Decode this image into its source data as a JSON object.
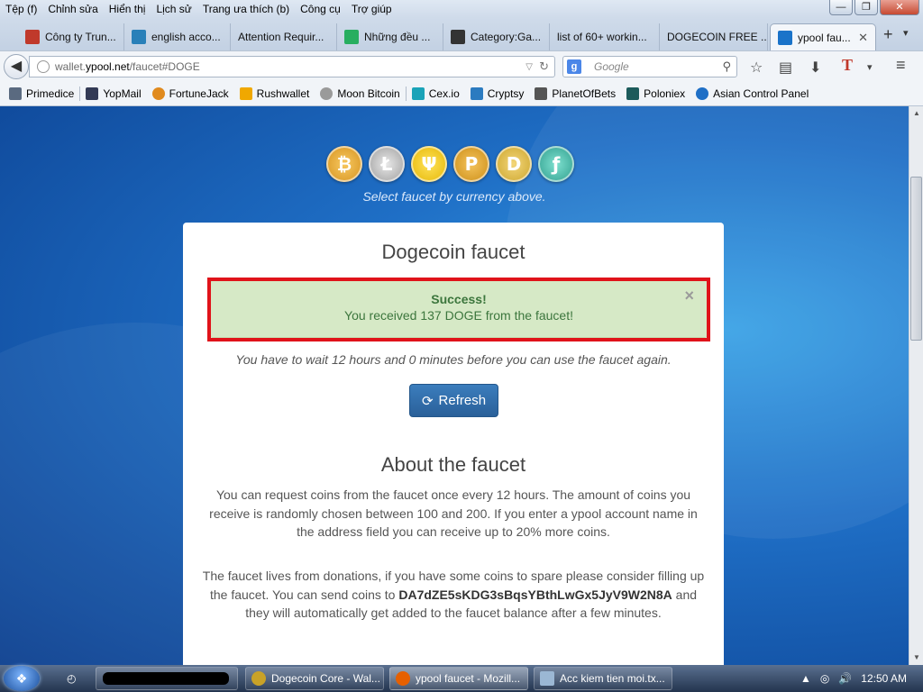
{
  "menubar": {
    "items": [
      "Tệp (f)",
      "Chỉnh sửa",
      "Hiển thị",
      "Lịch sử",
      "Trang ưa thích (b)",
      "Công cụ",
      "Trợ giúp"
    ]
  },
  "window_controls": {
    "minimize": "—",
    "maximize": "❐",
    "close": "✕"
  },
  "tabs": [
    {
      "label": "Công ty Trun...",
      "color": "#c0392b"
    },
    {
      "label": "english acco...",
      "color": "#2980b9"
    },
    {
      "label": "Attention Requir...",
      "color": "#888888"
    },
    {
      "label": "Những đều ...",
      "color": "#27ae60"
    },
    {
      "label": "Category:Ga...",
      "color": "#333333"
    },
    {
      "label": "list of 60+ workin...",
      "color": "#999999"
    },
    {
      "label": "DOGECOIN FREE ...",
      "color": "#aaaaaa"
    },
    {
      "label": "ypool fau...",
      "color": "#1a73c9",
      "active": true
    }
  ],
  "newtab": "+",
  "tabsdown": "▾",
  "tab_close": "✕",
  "nav": {
    "back": "◀",
    "url_prefix": "wallet.",
    "url_domain": "ypool.net",
    "url_suffix": "/faucet#DOGE",
    "search_placeholder": "Google",
    "search_engine": "g",
    "dropdown": "▽",
    "reload": "↻",
    "magnifier": "⚲",
    "icons": [
      "☆",
      "▤",
      "⬇",
      "T",
      "▾",
      "≡"
    ]
  },
  "bookmarks": [
    {
      "label": "Primedice",
      "color": "#5a6a80"
    },
    {
      "label": "YopMail",
      "color": "#333a55"
    },
    {
      "label": "FortuneJack",
      "color": "#e08a1e"
    },
    {
      "label": "Rushwallet",
      "color": "#f0a800"
    },
    {
      "label": "Moon Bitcoin",
      "color": "#9a9a9a"
    },
    {
      "label": "Cex.io",
      "color": "#1aa3b8"
    },
    {
      "label": "Cryptsy",
      "color": "#2b7bc0"
    },
    {
      "label": "PlanetOfBets",
      "color": "#555555"
    },
    {
      "label": "Poloniex",
      "color": "#1c5b5b"
    },
    {
      "label": "Asian Control Panel",
      "color": "#1f6fc6"
    }
  ],
  "coins": [
    {
      "name": "bitcoin",
      "glyph": "₿"
    },
    {
      "name": "litecoin",
      "glyph": "Ł"
    },
    {
      "name": "psi-coin",
      "glyph": "Ψ"
    },
    {
      "name": "peercoin",
      "glyph": "P"
    },
    {
      "name": "dogecoin",
      "glyph": "D"
    },
    {
      "name": "teal-coin",
      "glyph": "ƒ"
    }
  ],
  "select_hint": "Select faucet by currency above.",
  "faucet": {
    "title": "Dogecoin faucet",
    "alert_title": "Success!",
    "alert_message": "You received 137 DOGE from the faucet!",
    "alert_close": "×",
    "wait_message": "You have to wait 12 hours and 0 minutes before you can use the faucet again.",
    "refresh_label": "Refresh",
    "refresh_icon": "⟳",
    "about_title": "About the faucet",
    "about_p1": "You can request coins from the faucet once every 12 hours. The amount of coins you receive is randomly chosen between 100 and 200. If you enter a ypool account name in the address field you can receive up to 20% more coins.",
    "about_p2_a": "The faucet lives from donations, if you have some coins to spare please consider filling up the faucet. You can send coins to ",
    "about_address": "DA7dZE5sKDG3sBqsYBthLwGx5JyV9W2N8A",
    "about_p2_b": " and they will automatically get added to the faucet balance after a few minutes."
  },
  "scrollbar": {
    "up": "▲",
    "down": "▼"
  },
  "taskbar": {
    "start": "❖",
    "pinned": "◴",
    "tasks": [
      {
        "label": "Dogecoin Core - Wal...",
        "color": "#c9a227"
      },
      {
        "label": "ypool faucet - Mozill...",
        "color": "#e66000",
        "active": true
      },
      {
        "label": "Acc kiem tien moi.tx...",
        "color": "#9bb7d4"
      }
    ],
    "tray_icons": [
      "▲",
      "◎",
      "🔊"
    ],
    "clock": "12:50 AM"
  }
}
